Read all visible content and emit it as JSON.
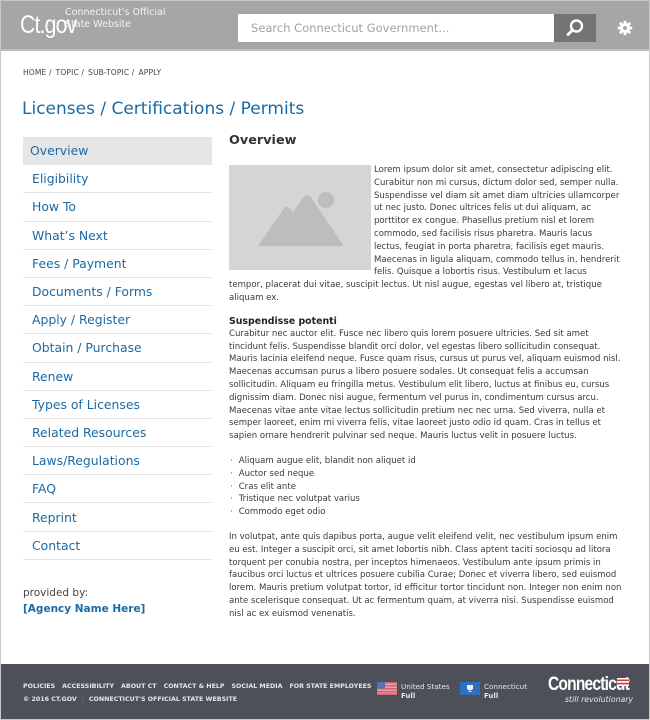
{
  "header": {
    "logo_text": "Ct.gov",
    "tagline_line1": "Connecticut's Official",
    "tagline_line2": "State Website",
    "search_placeholder": "Search Connecticut Government...",
    "search_icon": "search-icon",
    "settings_icon": "gear-icon"
  },
  "breadcrumb": [
    "HOME /",
    "TOPIC /",
    "SUB-TOPIC /",
    "APPLY"
  ],
  "page_title": "Licenses / Certifications / Permits",
  "sidebar": {
    "items": [
      {
        "label": "Overview",
        "active": true
      },
      {
        "label": "Eligibility"
      },
      {
        "label": "How To"
      },
      {
        "label": "What’s Next"
      },
      {
        "label": "Fees / Payment"
      },
      {
        "label": "Documents / Forms"
      },
      {
        "label": "Apply / Register"
      },
      {
        "label": "Obtain / Purchase"
      },
      {
        "label": "Renew"
      },
      {
        "label": "Types of Licenses"
      },
      {
        "label": "Related Resources"
      },
      {
        "label": "Laws/Regulations"
      },
      {
        "label": "FAQ"
      },
      {
        "label": "Reprint"
      },
      {
        "label": "Contact"
      }
    ],
    "provided_by_label": "provided by:",
    "agency_name": "[Agency Name Here]"
  },
  "main": {
    "heading": "Overview",
    "image_placeholder_icon": "image-placeholder-icon",
    "paragraph1": "Lorem ipsum dolor sit amet, consectetur adipiscing elit. Curabitur non mi cursus, dictum dolor sed, semper nulla. Suspendisse vel diam sit amet diam ultricies ullamcorper ut nec justo. Donec ultrices felis ut dui aliquam, ac porttitor ex congue. Phasellus pretium nisl et lorem commodo, sed facilisis risus pharetra. Mauris lacus lectus, feugiat in porta pharetra, facilisis eget mauris. Maecenas in ligula aliquam, commodo tellus in, hendrerit felis. Quisque a lobortis risus. Vestibulum et lacus tempor, placerat dui vitae, suscipit lectus. Ut nisl augue, egestas vel libero at, tristique aliquam ex.",
    "subheading": "Suspendisse potenti",
    "paragraph2": "Curabitur nec auctor elit. Fusce nec libero quis lorem posuere ultricies. Sed sit amet tincidunt felis. Suspendisse blandit orci dolor, vel egestas libero sollicitudin consequat. Mauris lacinia eleifend neque. Fusce quam risus, cursus ut purus vel, aliquam euismod nisl. Maecenas accumsan purus a libero posuere sodales. Ut consequat felis a accumsan sollicitudin. Aliquam eu fringilla metus. Vestibulum elit libero, luctus at finibus eu, cursus dignissim diam. Donec nisi augue, fermentum vel purus in, condimentum cursus arcu. Maecenas vitae ante vitae lectus sollicitudin pretium nec nec urna. Sed viverra, nulla et semper laoreet, enim mi viverra felis, vitae laoreet justo odio id quam. Cras in tellus et sapien ornare hendrerit pulvinar sed neque. Mauris luctus velit in posuere luctus.",
    "bullets": [
      "Aliquam augue elit, blandit non aliquet id",
      "Auctor sed neque",
      "Cras elit ante",
      "Tristique nec volutpat varius",
      "Commodo eget odio"
    ],
    "paragraph3": "In volutpat, ante quis dapibus porta, augue velit eleifend velit, nec vestibulum ipsum enim eu est. Integer a suscipit orci, sit amet lobortis nibh. Class aptent taciti sociosqu ad litora torquent per conubia nostra, per inceptos himenaeos. Vestibulum ante ipsum primis in faucibus orci luctus et ultrices posuere cubilia Curae; Donec et viverra libero, sed euismod lorem. Mauris pretium volutpat tortor, id efficitur tortor tincidunt non. Integer non enim non ante scelerisque consequat. Ut ac fermentum quam, at viverra nisi. Suspendisse euismod nisl ac ex euismod venenatis."
  },
  "footer": {
    "links": [
      "POLICIES",
      "ACCESSIBILITY",
      "ABOUT CT",
      "CONTACT & HELP",
      "SOCIAL MEDIA",
      "FOR STATE EMPLOYEES"
    ],
    "copyright": "© 2016 CT.GOV",
    "separator": "|",
    "site_name": "CONNECTICUT'S OFFICIAL STATE WEBSITE",
    "flags": [
      {
        "name": "United States",
        "status": "Full"
      },
      {
        "name": "Connecticut",
        "status": "Full"
      }
    ],
    "brand_name": "Connecticut",
    "brand_tagline": "still revolutionary"
  },
  "colors": {
    "header_bg": "#a6a6a6",
    "link_blue": "#1a6aa6",
    "footer_bg": "#4d5058",
    "active_nav_bg": "#e6e6e6"
  }
}
